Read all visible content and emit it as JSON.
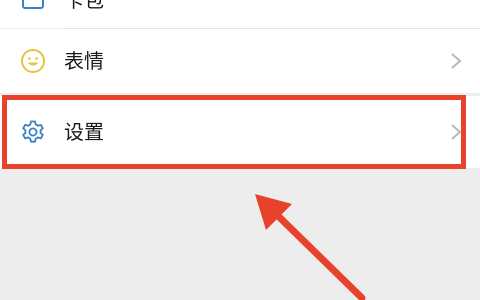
{
  "colors": {
    "page_background": "#ededed",
    "row_background": "#ffffff",
    "annotation_red": "#e8412c",
    "settings_icon_blue": "#3b82c4",
    "emoji_icon_yellow": "#e8c43a"
  },
  "menu": {
    "items": [
      {
        "label": "卡包",
        "icon": "wallet-icon"
      },
      {
        "label": "表情",
        "icon": "emoji-icon"
      },
      {
        "label": "设置",
        "icon": "gear-icon"
      }
    ]
  }
}
